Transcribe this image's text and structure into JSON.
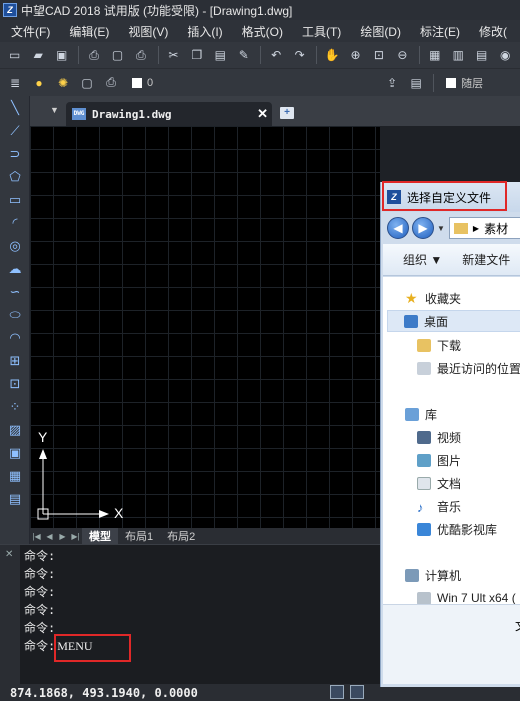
{
  "window": {
    "title": "中望CAD 2018 试用版 (功能受限) - [Drawing1.dwg]"
  },
  "menu": [
    "文件(F)",
    "编辑(E)",
    "视图(V)",
    "插入(I)",
    "格式(O)",
    "工具(T)",
    "绘图(D)",
    "标注(E)",
    "修改("
  ],
  "layer": {
    "current": "0",
    "linetype": "随层"
  },
  "document_tab": {
    "label": "Drawing1.dwg"
  },
  "layout_tabs": [
    "模型",
    "布局1",
    "布局2"
  ],
  "ucs": {
    "x_label": "X",
    "y_label": "Y"
  },
  "command": {
    "prompt": "命令:",
    "lines": [
      "命令:",
      "命令:",
      "命令:",
      "命令:",
      "命令:"
    ],
    "input": "MENU"
  },
  "status": {
    "coords": "874.1868, 493.1940, 0.0000"
  },
  "dialog": {
    "title": "选择自定义文件",
    "address": "素材",
    "organize": "组织 ▼",
    "new_folder": "新建文件",
    "nav": {
      "favorites": "收藏夹",
      "desktop": "桌面",
      "downloads": "下载",
      "recent": "最近访问的位置",
      "libraries": "库",
      "videos": "视频",
      "pictures": "图片",
      "documents": "文档",
      "music": "音乐",
      "youku": "优酷影视库",
      "computer": "计算机",
      "drive": "Win 7 Ult x64 ("
    },
    "bottom_label": "文"
  },
  "colors": {
    "highlight_box": "#e02828",
    "canvas": "#000000",
    "accent": "#8fc0ff"
  }
}
